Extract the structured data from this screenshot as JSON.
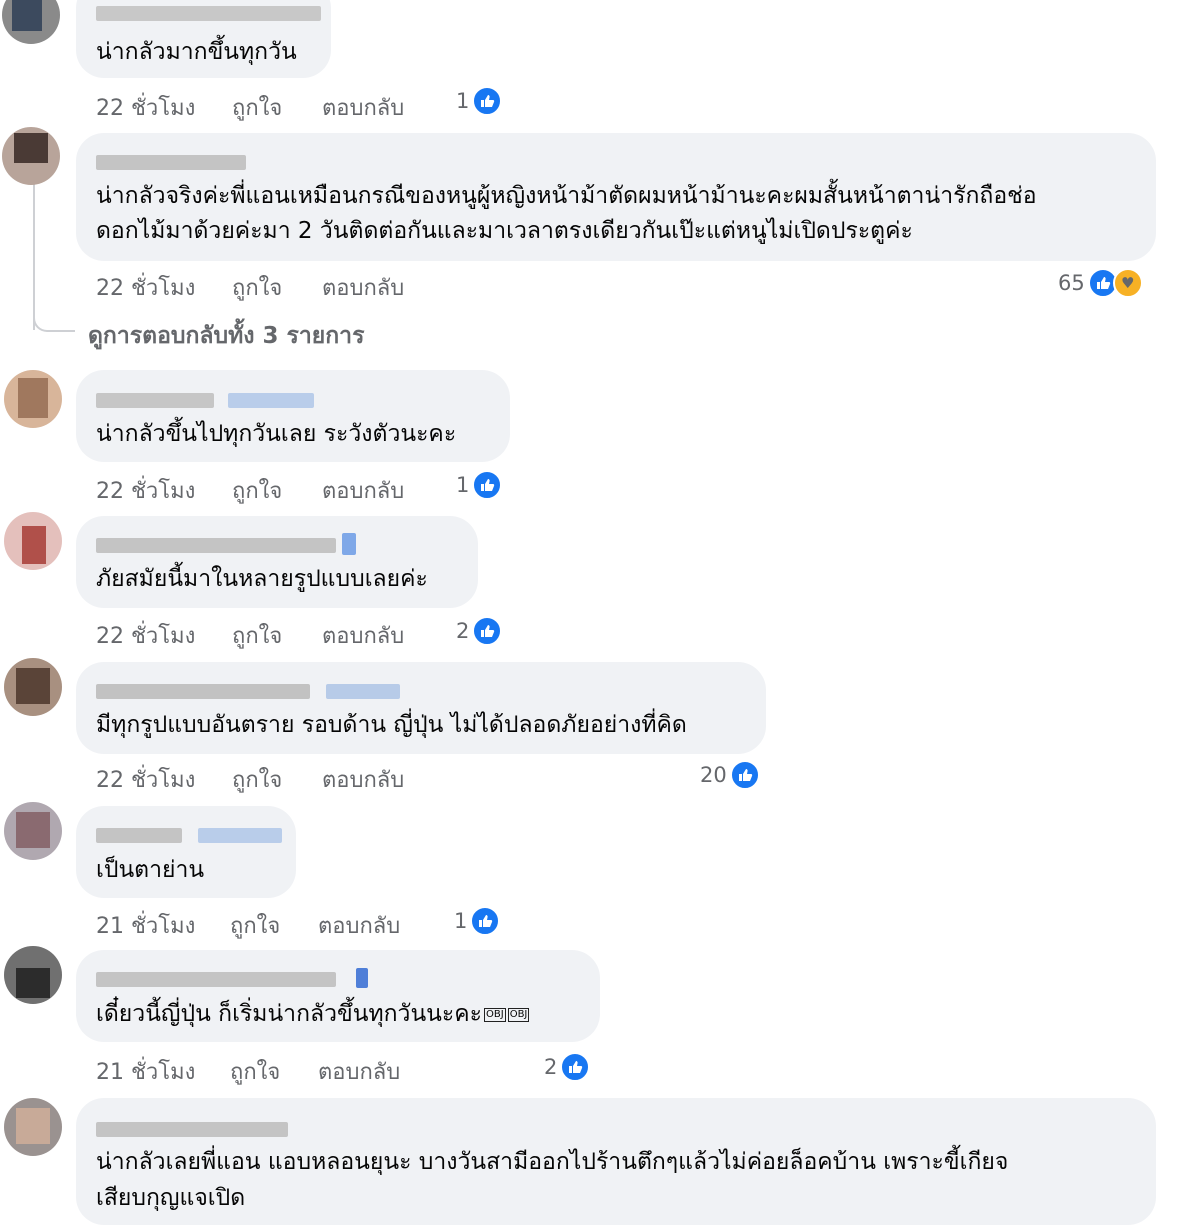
{
  "comments": [
    {
      "text": "น่ากลัวมากขึ้นทุกวัน",
      "time": "22 ชั่วโมง",
      "like": "ถูกใจ",
      "reply": "ตอบกลับ",
      "count": "1"
    },
    {
      "text_line1": "น่ากลัวจริงค่ะพี่แอนเหมือนกรณีของหนูผู้หญิงหน้าม้าตัดผมหน้าม้านะคะผมสั้นหน้าตาน่ารักถือช่อ",
      "text_line2": "ดอกไม้มาด้วยค่ะมา 2 วันติดต่อกันและมาเวลาตรงเดียวกันเป๊ะแต่หนูไม่เปิดประตูค่ะ",
      "time": "22 ชั่วโมง",
      "like": "ถูกใจ",
      "reply": "ตอบกลับ",
      "count": "65"
    },
    {
      "text": "น่ากลัวขึ้นไปทุกวันเลย ระวังตัวนะคะ",
      "time": "22 ชั่วโมง",
      "like": "ถูกใจ",
      "reply": "ตอบกลับ",
      "count": "1"
    },
    {
      "text": "ภัยสมัยนี้มาในหลายรูปแบบเลยค่ะ",
      "time": "22 ชั่วโมง",
      "like": "ถูกใจ",
      "reply": "ตอบกลับ",
      "count": "2"
    },
    {
      "text": "มีทุกรูปแบบอันตราย รอบด้าน ญี่ปุ่น ไม่ได้ปลอดภัยอย่างที่คิด",
      "time": "22 ชั่วโมง",
      "like": "ถูกใจ",
      "reply": "ตอบกลับ",
      "count": "20"
    },
    {
      "text": "เป็นตาย่าน",
      "time": "21 ชั่วโมง",
      "like": "ถูกใจ",
      "reply": "ตอบกลับ",
      "count": "1"
    },
    {
      "text": "เดี๋ยวนี้ญี่ปุ่น ก็เริ่มน่ากลัวขึ้นทุกวันนะคะ",
      "emoji1": "OBJ",
      "emoji2": "OBJ",
      "time": "21 ชั่วโมง",
      "like": "ถูกใจ",
      "reply": "ตอบกลับ",
      "count": "2"
    },
    {
      "text_line1": "น่ากลัวเลยพี่แอน แอบหลอนยุนะ บางวันสามีออกไปร้านตึกๆแล้วไม่ค่อยล็อคบ้าน เพราะขี้เกียจ",
      "text_line2": "เสียบกุญแจเปิด"
    }
  ],
  "view_replies": "ดูการตอบกลับทั้ง 3 รายการ",
  "icons": {
    "like": "like-reaction-icon",
    "love": "care-reaction-icon"
  },
  "colors": {
    "bubble": "#f0f2f5",
    "meta": "#65676b",
    "like_blue": "#1877f2"
  }
}
